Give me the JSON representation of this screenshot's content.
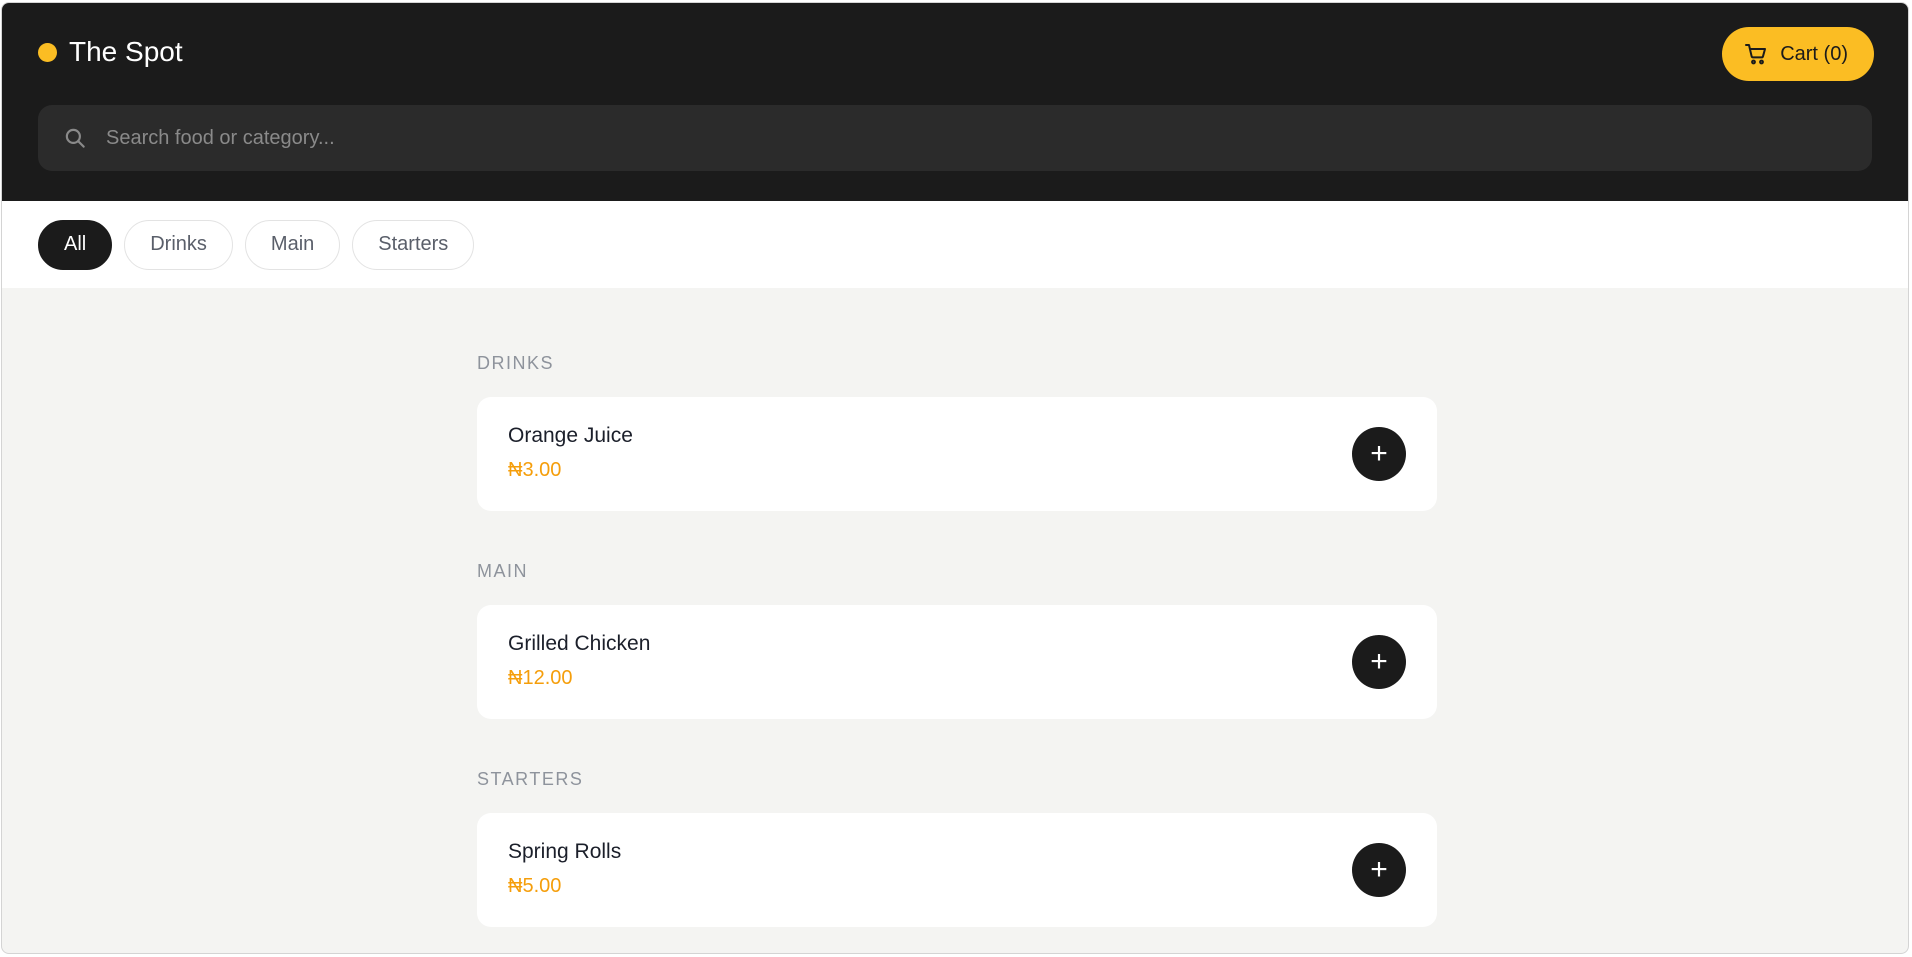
{
  "header": {
    "brand_name": "The Spot",
    "cart_label": "Cart (0)",
    "search": {
      "placeholder": "Search food or category..."
    }
  },
  "filters": [
    {
      "label": "All",
      "active": true
    },
    {
      "label": "Drinks",
      "active": false
    },
    {
      "label": "Main",
      "active": false
    },
    {
      "label": "Starters",
      "active": false
    }
  ],
  "sections": [
    {
      "heading": "DRINKS",
      "items": [
        {
          "name": "Orange Juice",
          "price": "₦3.00",
          "add_label": "+"
        }
      ]
    },
    {
      "heading": "MAIN",
      "items": [
        {
          "name": "Grilled Chicken",
          "price": "₦12.00",
          "add_label": "+"
        }
      ]
    },
    {
      "heading": "STARTERS",
      "items": [
        {
          "name": "Spring Rolls",
          "price": "₦5.00",
          "add_label": "+"
        }
      ]
    }
  ],
  "colors": {
    "accent": "#fbbd23",
    "price": "#f59e0b",
    "header_bg": "#1b1b1b",
    "page_bg": "#f4f4f2"
  },
  "icons": {
    "cart": "cart-icon",
    "search": "search-icon",
    "brand_dot": "status-dot-icon"
  }
}
